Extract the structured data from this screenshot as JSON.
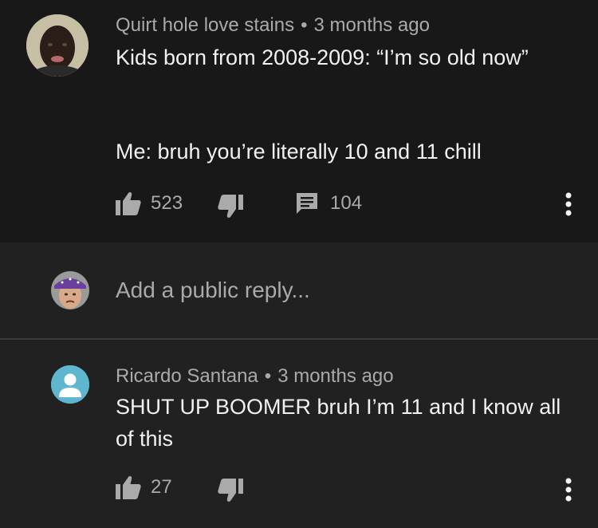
{
  "comment": {
    "author": "Quirt hole love stains",
    "separator": "•",
    "time": "3 months ago",
    "line1": "Kids born from 2008-2009: “I’m so old now”",
    "line2": "Me: bruh you’re literally 10 and 11 chill",
    "likes": "523",
    "replies": "104",
    "avatar_icon": "person-avatar"
  },
  "reply_box": {
    "placeholder": "Add a public reply...",
    "avatar_icon": "bandana-avatar"
  },
  "reply": {
    "author": "Ricardo Santana",
    "separator": "•",
    "time": "3 months ago",
    "text": "SHUT UP BOOMER bruh I’m 11 and I know all of this",
    "likes": "27",
    "avatar_icon": "default-user-avatar"
  },
  "colors": {
    "background": "#181818",
    "reply_bg": "#212121",
    "secondary_text": "#aaaaaa",
    "primary_text": "#f1f1f1",
    "default_avatar": "#5fb7cf"
  }
}
